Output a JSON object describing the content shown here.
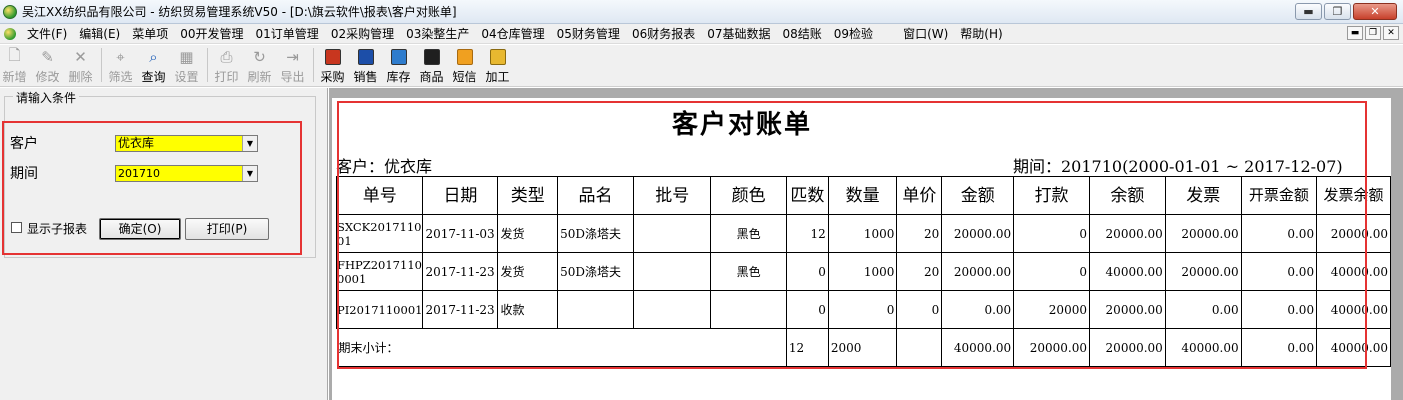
{
  "window": {
    "title": "吴江XX纺织品有限公司 - 纺织贸易管理系统V50 - [D:\\旗云软件\\报表\\客户对账单]",
    "min": "▬",
    "restore": "❐",
    "close": "✕"
  },
  "menubar": {
    "items": [
      "文件(F)",
      "编辑(E)",
      "菜单项",
      "00开发管理",
      "01订单管理",
      "02采购管理",
      "03染整生产",
      "04仓库管理",
      "05财务管理",
      "06财务报表",
      "07基础数据",
      "08结账",
      "09检验"
    ],
    "right_items": [
      "窗口(W)",
      "帮助(H)"
    ]
  },
  "toolbar": {
    "buttons": [
      {
        "label": "新增",
        "icon": "new-file-icon",
        "glyph": "🗋",
        "enabled": false
      },
      {
        "label": "修改",
        "icon": "edit-icon",
        "glyph": "✎",
        "enabled": false
      },
      {
        "label": "删除",
        "icon": "delete-icon",
        "glyph": "✕",
        "enabled": false
      },
      {
        "label": "筛选",
        "icon": "filter-icon",
        "glyph": "⌖",
        "enabled": false
      },
      {
        "label": "查询",
        "icon": "query-icon",
        "glyph": "⌕",
        "enabled": true
      },
      {
        "label": "设置",
        "icon": "settings-icon",
        "glyph": "▦",
        "enabled": false
      },
      {
        "label": "打印",
        "icon": "print-icon",
        "glyph": "⎙",
        "enabled": false
      },
      {
        "label": "刷新",
        "icon": "refresh-icon",
        "glyph": "↻",
        "enabled": false
      },
      {
        "label": "导出",
        "icon": "export-icon",
        "glyph": "⇥",
        "enabled": false
      },
      {
        "label": "采购",
        "icon": "purchase-icon",
        "color": "#c8361f",
        "enabled": true
      },
      {
        "label": "销售",
        "icon": "sales-icon",
        "color": "#1c4ea8",
        "enabled": true
      },
      {
        "label": "库存",
        "icon": "inventory-icon",
        "color": "#2e7ccd",
        "enabled": true
      },
      {
        "label": "商品",
        "icon": "goods-icon",
        "color": "#1f1f1f",
        "enabled": true
      },
      {
        "label": "短信",
        "icon": "sms-icon",
        "color": "#f0a020",
        "enabled": true
      },
      {
        "label": "加工",
        "icon": "process-icon",
        "color": "#e8b830",
        "enabled": true
      }
    ]
  },
  "conditions": {
    "legend": "请输入条件",
    "customer_label": "客户",
    "customer_value": "优衣库",
    "period_label": "期间",
    "period_value": "201710",
    "show_sub_report": "显示子报表",
    "confirm_button": "确定(O)",
    "print_button": "打印(P)"
  },
  "report": {
    "title": "客户对账单",
    "customer_line": "客户：优衣库",
    "period_line": "期间：201710(2000-01-01 ~ 2017-12-07)",
    "columns": [
      "单号",
      "日期",
      "类型",
      "品名",
      "批号",
      "颜色",
      "匹数",
      "数量",
      "单价",
      "金额",
      "打款",
      "余额",
      "发票",
      "开票金额",
      "发票余额"
    ],
    "rows": [
      [
        "SXCK201711001",
        "2017-11-03",
        "发货",
        "50D涤塔夫",
        "",
        "黑色",
        "12",
        "1000",
        "20",
        "20000.00",
        "0",
        "20000.00",
        "20000.00",
        "0.00",
        "20000.00"
      ],
      [
        "FHPZ20171100001",
        "2017-11-23",
        "发货",
        "50D涤塔夫",
        "",
        "黑色",
        "0",
        "1000",
        "20",
        "20000.00",
        "0",
        "40000.00",
        "20000.00",
        "0.00",
        "40000.00"
      ],
      [
        "PI2017110001",
        "2017-11-23",
        "收款",
        "",
        "",
        "",
        "0",
        "0",
        "0",
        "0.00",
        "20000",
        "20000.00",
        "0.00",
        "0.00",
        "40000.00"
      ]
    ],
    "total": {
      "label": "期末小计：",
      "pieces": "12",
      "qty": "2000",
      "amount": "40000.00",
      "paid": "20000.00",
      "balance": "20000.00",
      "invoice": "40000.00",
      "invoiced": "0.00",
      "invoice_balance": "40000.00"
    }
  }
}
